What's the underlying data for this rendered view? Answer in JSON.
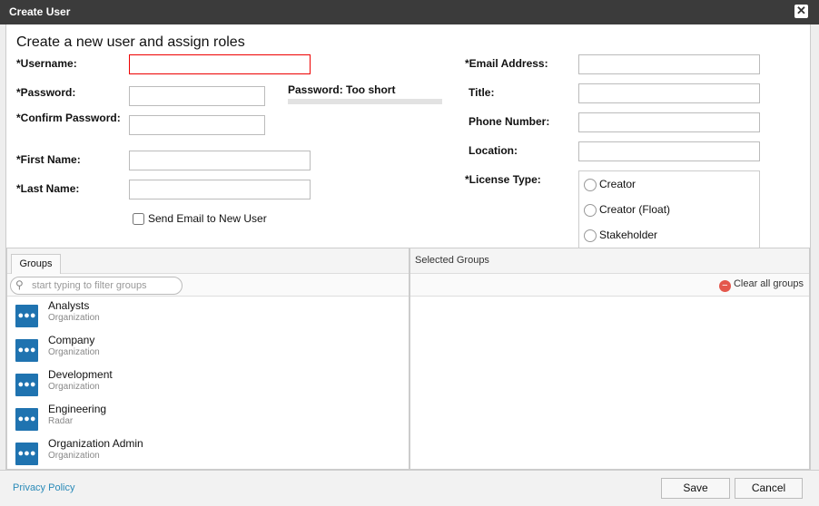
{
  "dialog": {
    "title": "Create User",
    "close_label": "✕"
  },
  "form": {
    "heading": "Create a new user and assign roles",
    "username_label": "*Username:",
    "password_label": "*Password:",
    "confirm_label": "*Confirm Password:",
    "first_name_label": "*First Name:",
    "last_name_label": "*Last Name:",
    "send_email_label": "Send Email to New User",
    "password_strength": "Password: Too short",
    "email_label": "*Email Address:",
    "title_label": "Title:",
    "phone_label": "Phone Number:",
    "location_label": "Location:",
    "license_label": "*License Type:",
    "license_options": [
      "Creator",
      "Creator (Float)",
      "Stakeholder"
    ]
  },
  "groups": {
    "tab": "Groups",
    "filter_placeholder": "start typing to filter groups",
    "items": [
      {
        "name": "Analysts",
        "type": "Organization"
      },
      {
        "name": "Company",
        "type": "Organization"
      },
      {
        "name": "Development",
        "type": "Organization"
      },
      {
        "name": "Engineering",
        "type": "Radar"
      },
      {
        "name": "Organization Admin",
        "type": "Organization"
      }
    ]
  },
  "selected": {
    "title": "Selected Groups",
    "clear_label": "Clear all groups"
  },
  "footer": {
    "privacy": "Privacy Policy",
    "save": "Save",
    "cancel": "Cancel"
  },
  "colors": {
    "accent": "#1f73b0",
    "error": "#e00000"
  }
}
